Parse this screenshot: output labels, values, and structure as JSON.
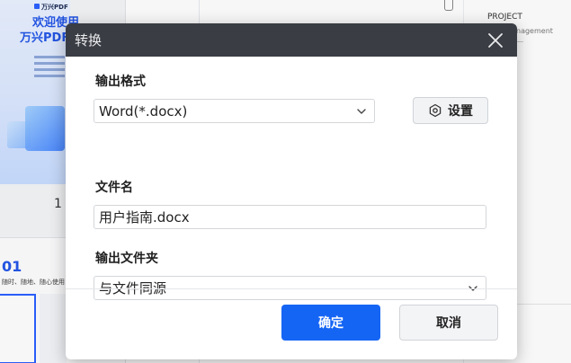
{
  "background": {
    "thumb1": {
      "brand": "万兴PDF",
      "welcome_line1": "欢迎使用",
      "welcome_line2": "万兴PDF"
    },
    "page_number": "1",
    "thumb2": {
      "section_number": "01",
      "subtitle": "随时、随地、随心使用"
    },
    "right_panel": {
      "project": "PROJECT",
      "management": "nagement"
    }
  },
  "dialog": {
    "title": "转换",
    "output_format": {
      "label": "输出格式",
      "selected": "Word(*.docx)"
    },
    "settings_label": "设置",
    "file_name": {
      "label": "文件名",
      "value": "用户指南.docx"
    },
    "output_folder": {
      "label": "输出文件夹",
      "selected": "与文件同源"
    },
    "ok_label": "确定",
    "cancel_label": "取消"
  }
}
